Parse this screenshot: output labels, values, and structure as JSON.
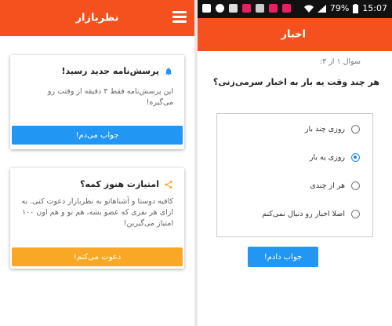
{
  "left_screen": {
    "app_title": "نظربازار",
    "cards": [
      {
        "title": "پرسش‌نامه جدید رسید!",
        "body": "این پرسش‌نامه فقط ۳ دقیقه از وقتت رو می‌گیره!",
        "button": "جواب می‌دم!",
        "button_color": "#2196f3",
        "icon": "bell-icon"
      },
      {
        "title": "امتیازت هنوز کمه؟",
        "body": "کافیه دوستا و آشناهاتو به نظربازار دعوت کنی. به ازای هر نفری که عضو بشه، هم تو و هم اون ۱۰۰ امتیاز می‌گیرین!",
        "button": "دعوت می‌کنم!",
        "button_color": "#f9a825",
        "icon": "share-icon"
      }
    ]
  },
  "right_screen": {
    "status_bar": {
      "battery": "79%",
      "time": "15:07"
    },
    "app_title": "اخبار",
    "question_counter": "سوال ۱ از ۳:",
    "question": "هر چند وقت یه بار به اخبار سرمی‌زنی؟",
    "options": [
      {
        "label": "روزی چند بار",
        "selected": false
      },
      {
        "label": "روزی یه بار",
        "selected": true
      },
      {
        "label": "هر از چندی",
        "selected": false
      },
      {
        "label": "اصلا اخبار رو دنبال نمی‌کنم",
        "selected": false
      }
    ],
    "submit": "جواب دادم!"
  },
  "colors": {
    "app_bar": "#f4511e",
    "accent": "#2196f3"
  }
}
